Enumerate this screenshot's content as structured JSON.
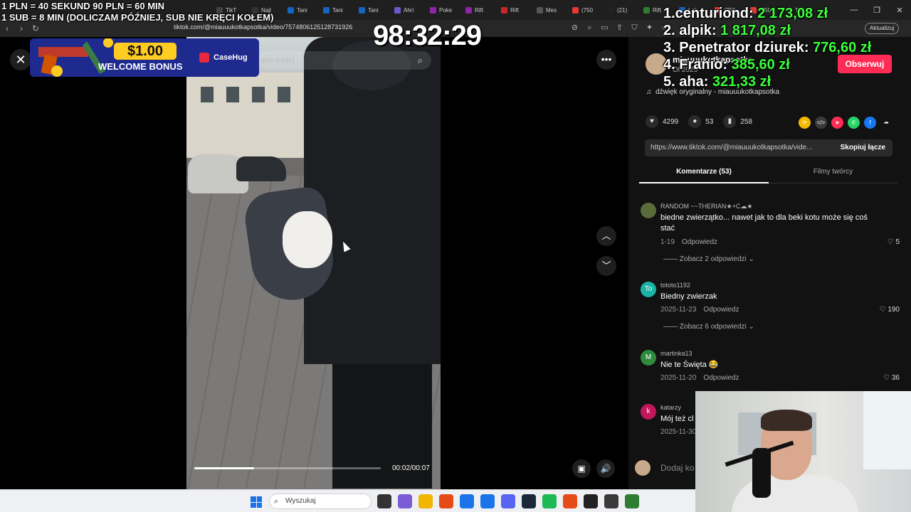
{
  "browser": {
    "tabs": [
      "TikT",
      "Najl",
      "Tani",
      "Tani",
      "Tani",
      "Ahri",
      "Poke",
      "Rift",
      "Rift",
      "Mes",
      "(750",
      "(21)",
      "Rift",
      "LoL",
      "(750",
      "(750",
      "Tikt"
    ],
    "url": "tiktok.com/@miauuukotkapsotka/video/7574806125128731926",
    "update_label": "Aktualizuj",
    "tab_colors": [
      "#444",
      "#333",
      "#1565c0",
      "#1565c0",
      "#1565c0",
      "#6a5acd",
      "#8e24aa",
      "#8e24aa",
      "#c62828",
      "#555",
      "#e53935",
      "#222",
      "#2e7d32",
      "#1565c0",
      "#e53935",
      "#e53935",
      "#222"
    ]
  },
  "overlay": {
    "line1": "1 PLN = 40 SEKUND 90 PLN = 60 MIN",
    "line2": "1 SUB = 8 MIN (DOLICZAM PÓŹNIEJ, SUB NIE KRĘCI KOŁEM)",
    "timer": "98:32:29",
    "leaderboard": [
      {
        "name": "1.centuriond:",
        "amount": "2 173,08 zł"
      },
      {
        "name": "2. alpik:",
        "amount": "1 817,08 zł"
      },
      {
        "name": "3. Penetrator dziurek:",
        "amount": "776,60 zł"
      },
      {
        "name": "4. Franio:",
        "amount": "385,60 zł"
      },
      {
        "name": "5. aha:",
        "amount": "321,33 zł"
      }
    ],
    "promo": {
      "price": "$1.00",
      "bonus": "WELCOME BONUS",
      "brand": "CaseHug"
    }
  },
  "video": {
    "search_placeholder": "ane treści",
    "time": "00:02/00:07",
    "progress": 0.32
  },
  "panel": {
    "username": "miauuukotkapsotka",
    "subuser": "Ol 2025",
    "follow_label": "Obserwuj",
    "music": "dźwięk oryginalny - miauuukotkapsotka",
    "likes": "4299",
    "comments_count": "53",
    "saves": "258",
    "share_url": "https://www.tiktok.com/@miauuukotkapsotka/vide...",
    "copy_label": "Skopiuj łącze",
    "tab_comments": "Komentarze (53)",
    "tab_creator": "Filmy twórcy",
    "add_comment": "Dodaj ko",
    "comments": [
      {
        "avatar": "",
        "avatar_color": "#5a6b3a",
        "name": "RANDOM ~~THERIAN★+C☁★",
        "text": "biedne zwierzątko... nawet jak to dla beki kotu może się coś stać",
        "date": "1-19",
        "reply": "Odpowiedz",
        "likes": "5",
        "replies": "Zobacz 2 odpowiedzi"
      },
      {
        "avatar": "To",
        "avatar_color": "#1ab3a6",
        "name": "tototo1192",
        "text": "Biedny zwierzak",
        "date": "2025-11-23",
        "reply": "Odpowiedz",
        "likes": "190",
        "replies": "Zobacz 6 odpowiedzi"
      },
      {
        "avatar": "M",
        "avatar_color": "#2e8b3e",
        "name": "martinka13",
        "text": "Nie te Święta 😂",
        "date": "2025-11-20",
        "reply": "Odpowiedz",
        "likes": "36",
        "replies": ""
      },
      {
        "avatar": "k",
        "avatar_color": "#c2185b",
        "name": "katarzy",
        "text": "Mój też cl",
        "date": "2025-11-30",
        "reply": "",
        "likes": "",
        "replies": ""
      }
    ]
  },
  "taskbar": {
    "search_label": "Wyszukaj",
    "icon_colors": [
      "#333",
      "#7b5cd6",
      "#f2b600",
      "#e64a19",
      "#1a73e8",
      "#1a73e8",
      "#5865f2",
      "#1b2838",
      "#1db954",
      "#e64a19",
      "#222",
      "#3a3a3a",
      "#2e7d32"
    ]
  }
}
